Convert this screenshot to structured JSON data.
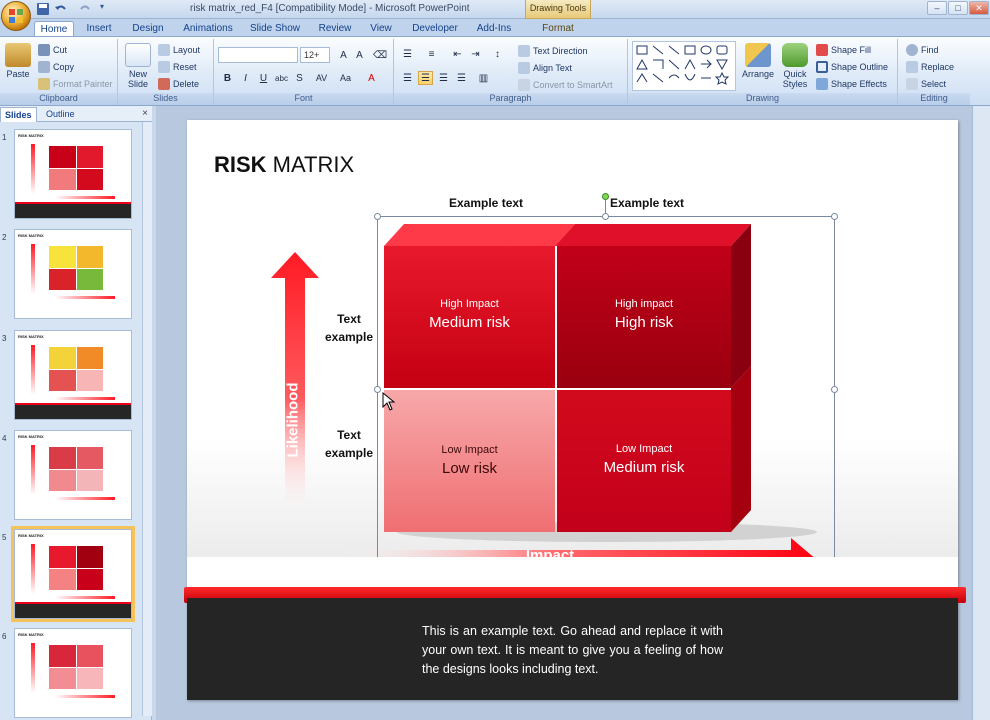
{
  "window": {
    "title": "risk matrix_red_F4 [Compatibility Mode] - Microsoft PowerPoint",
    "contextual_group": "Drawing Tools"
  },
  "tabs": [
    "Home",
    "Insert",
    "Design",
    "Animations",
    "Slide Show",
    "Review",
    "View",
    "Developer",
    "Add-Ins",
    "Format"
  ],
  "ribbon": {
    "clipboard": {
      "paste": "Paste",
      "cut": "Cut",
      "copy": "Copy",
      "format_painter": "Format Painter",
      "label": "Clipboard"
    },
    "slides": {
      "new_slide": "New Slide",
      "layout": "Layout",
      "reset": "Reset",
      "delete": "Delete",
      "label": "Slides"
    },
    "font": {
      "font_size": "12+",
      "label": "Font"
    },
    "paragraph": {
      "text_direction": "Text Direction",
      "align_text": "Align Text",
      "convert_smartart": "Convert to SmartArt",
      "label": "Paragraph"
    },
    "drawing": {
      "arrange": "Arrange",
      "quick_styles": "Quick Styles",
      "shape_fill": "Shape Fill",
      "shape_outline": "Shape Outline",
      "shape_effects": "Shape Effects",
      "label": "Drawing"
    },
    "editing": {
      "find": "Find",
      "replace": "Replace",
      "select": "Select",
      "label": "Editing"
    }
  },
  "slides_panel": {
    "tab_slides": "Slides",
    "tab_outline": "Outline",
    "close": "×",
    "thumbnails": [
      {
        "number": "1",
        "title": "RISK MATRIX"
      },
      {
        "number": "2",
        "title": "RISK MATRIX"
      },
      {
        "number": "3",
        "title": "RISK MATRIX"
      },
      {
        "number": "4",
        "title": "RISK MATRIX"
      },
      {
        "number": "5",
        "title": "RISK MATRIX"
      },
      {
        "number": "6",
        "title": "RISK MATRIX"
      }
    ],
    "selected_index": 5
  },
  "slide": {
    "title_bold": "RISK",
    "title_rest": " MATRIX",
    "column_headers": [
      "Example text",
      "Example text"
    ],
    "row_labels": [
      "Text example",
      "Text example"
    ],
    "cells": [
      {
        "top": "High Impact",
        "big": "Medium risk"
      },
      {
        "top": "High impact",
        "big": "High risk"
      },
      {
        "top": "Low Impact",
        "big": "Low risk"
      },
      {
        "top": "Low Impact",
        "big": "Medium risk"
      }
    ],
    "y_axis_label": "Likelihood",
    "x_axis_label": "Impact",
    "body_text": "This is an example text. Go ahead and replace it with your own text. It is meant to give you a feeling of how the designs looks including text."
  },
  "colors": {
    "accent_red": "#e8001a",
    "dark_red": "#a0000f",
    "light_red": "#f48283",
    "ribbon_blue": "#15428b"
  }
}
